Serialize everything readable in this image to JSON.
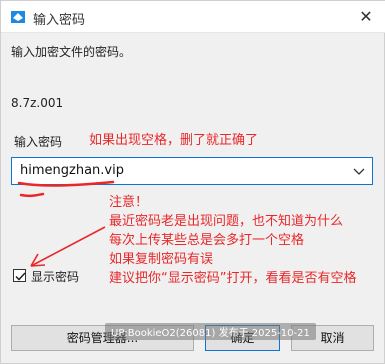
{
  "window": {
    "title": "输入密码",
    "close_glyph": "✕",
    "app_icon": "archive-app-icon",
    "accent": "#0b75d7"
  },
  "dialog": {
    "prompt": "输入加密文件的密码。",
    "filename": "8.7z.001",
    "password_label": "输入密码",
    "password_value": "himengzhan.vip",
    "show_password_label": "显示密码",
    "show_password_checked": true
  },
  "buttons": {
    "manager": "密码管理器...",
    "ok": "确定",
    "cancel": "取消"
  },
  "annotations": {
    "color": "#e8282b",
    "top_note": "如果出现空格，删了就正确了",
    "lines": [
      "注意！",
      "最近密码老是出现问题，也不知道为什么",
      "每次上传某些总是会多打一个空格",
      "如果复制密码有误",
      "建议把你“显示密码”打开，看看是否有空格"
    ]
  },
  "watermark": {
    "text": "UP:BookieO2(26081) 发布于 2025-10-21"
  }
}
